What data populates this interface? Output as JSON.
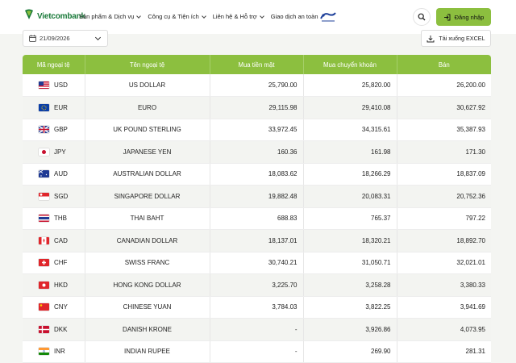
{
  "header": {
    "logo_text": "Vietcombank",
    "nav": [
      {
        "label": "Sản phẩm & Dịch vụ",
        "has_dropdown": true
      },
      {
        "label": "Công cụ & Tiện ích",
        "has_dropdown": true
      },
      {
        "label": "Liên hệ & Hỗ trợ",
        "has_dropdown": true
      },
      {
        "label": "Giao dịch an toàn",
        "has_dropdown": false
      }
    ],
    "login_label": "Đăng nhập",
    "accent_color": "#8cbf3f"
  },
  "toolbar": {
    "date_value": "21/09/2026",
    "excel_label": "Tải xuống EXCEL"
  },
  "table": {
    "headers": [
      "Mã ngoại tệ",
      "Tên ngoại tệ",
      "Mua tiền mặt",
      "Mua chuyển khoản",
      "Bán"
    ],
    "rows": [
      {
        "code": "USD",
        "flag": "us-flag",
        "name": "US DOLLAR",
        "cash": "25,790.00",
        "transfer": "25,820.00",
        "sell": "26,200.00"
      },
      {
        "code": "EUR",
        "flag": "eu-flag",
        "name": "EURO",
        "cash": "29,115.98",
        "transfer": "29,410.08",
        "sell": "30,627.92"
      },
      {
        "code": "GBP",
        "flag": "gb-flag",
        "name": "UK POUND STERLING",
        "cash": "33,972.45",
        "transfer": "34,315.61",
        "sell": "35,387.93"
      },
      {
        "code": "JPY",
        "flag": "jp-flag",
        "name": "JAPANESE YEN",
        "cash": "160.36",
        "transfer": "161.98",
        "sell": "171.30"
      },
      {
        "code": "AUD",
        "flag": "au-flag",
        "name": "AUSTRALIAN DOLLAR",
        "cash": "18,083.62",
        "transfer": "18,266.29",
        "sell": "18,837.09"
      },
      {
        "code": "SGD",
        "flag": "sg-flag",
        "name": "SINGAPORE DOLLAR",
        "cash": "19,882.48",
        "transfer": "20,083.31",
        "sell": "20,752.36"
      },
      {
        "code": "THB",
        "flag": "th-flag",
        "name": "THAI BAHT",
        "cash": "688.83",
        "transfer": "765.37",
        "sell": "797.22"
      },
      {
        "code": "CAD",
        "flag": "ca-flag",
        "name": "CANADIAN DOLLAR",
        "cash": "18,137.01",
        "transfer": "18,320.21",
        "sell": "18,892.70"
      },
      {
        "code": "CHF",
        "flag": "ch-flag",
        "name": "SWISS FRANC",
        "cash": "30,740.21",
        "transfer": "31,050.71",
        "sell": "32,021.01"
      },
      {
        "code": "HKD",
        "flag": "hk-flag",
        "name": "HONG KONG DOLLAR",
        "cash": "3,225.70",
        "transfer": "3,258.28",
        "sell": "3,380.33"
      },
      {
        "code": "CNY",
        "flag": "cn-flag",
        "name": "CHINESE YUAN",
        "cash": "3,784.03",
        "transfer": "3,822.25",
        "sell": "3,941.69"
      },
      {
        "code": "DKK",
        "flag": "dk-flag",
        "name": "DANISH KRONE",
        "cash": "-",
        "transfer": "3,926.86",
        "sell": "4,073.95"
      },
      {
        "code": "INR",
        "flag": "in-flag",
        "name": "INDIAN RUPEE",
        "cash": "-",
        "transfer": "269.90",
        "sell": "281.31"
      }
    ]
  }
}
